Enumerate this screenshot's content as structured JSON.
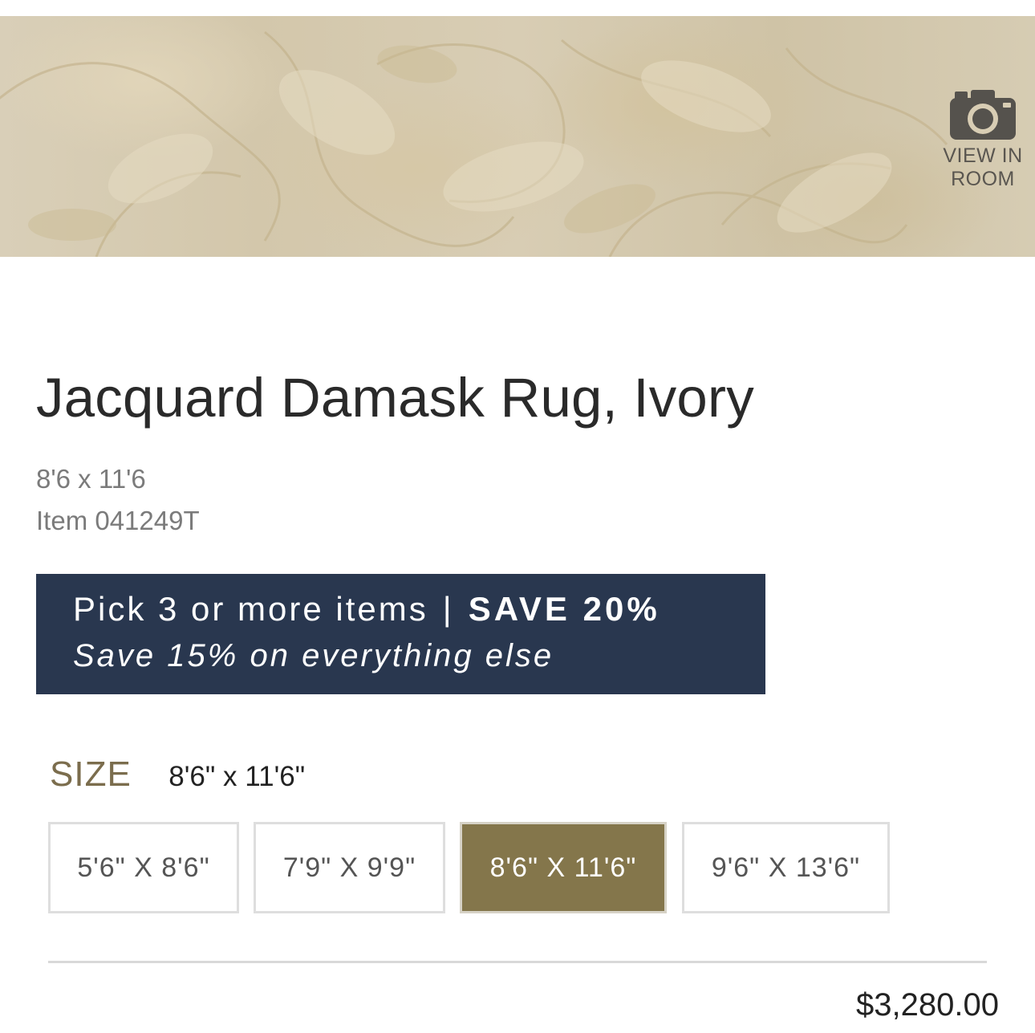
{
  "hero": {
    "view_in_room_line1": "VIEW IN",
    "view_in_room_line2": "ROOM",
    "camera_icon": "camera-icon"
  },
  "product": {
    "title": "Jacquard Damask Rug, Ivory",
    "dimensions": "8'6 x 11'6",
    "item_number": "Item 041249T"
  },
  "promo": {
    "line1_prefix": "Pick 3 or more items",
    "separator": "|",
    "line1_highlight": "SAVE 20%",
    "line2": "Save 15% on everything else",
    "background_color": "#29374f"
  },
  "size": {
    "label": "SIZE",
    "selected_value": "8'6\" x 11'6\"",
    "options": [
      {
        "label": "5'6\" X 8'6\"",
        "selected": false
      },
      {
        "label": "7'9\" X 9'9\"",
        "selected": false
      },
      {
        "label": "8'6\" X 11'6\"",
        "selected": true
      },
      {
        "label": "9'6\" X 13'6\"",
        "selected": false
      }
    ],
    "selected_color": "#84764b"
  },
  "price": "$3,280.00"
}
